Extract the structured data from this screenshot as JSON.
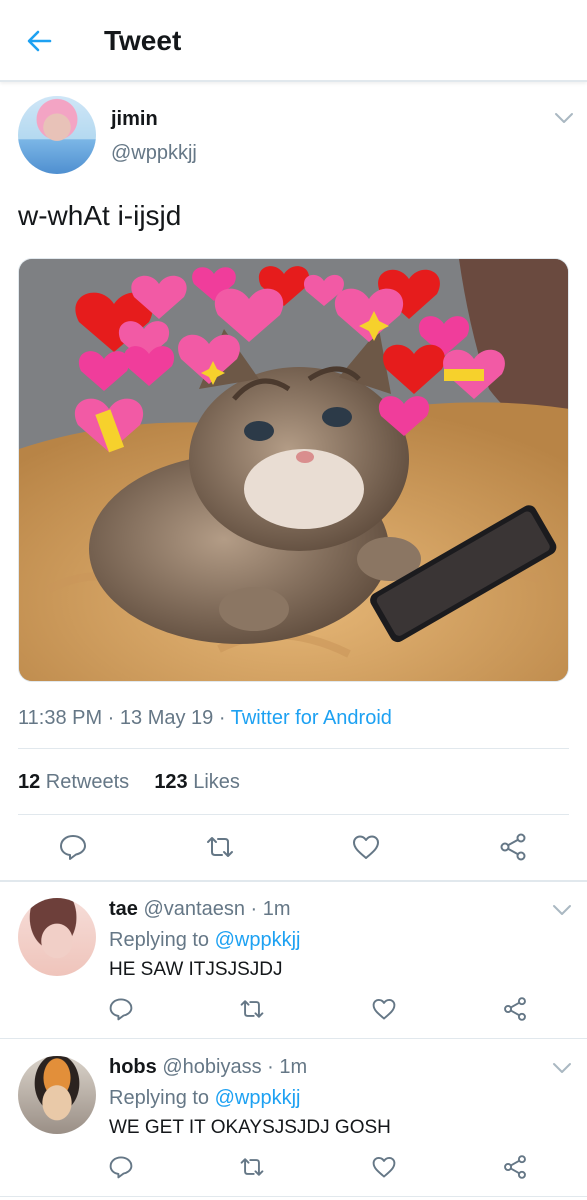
{
  "header": {
    "title": "Tweet"
  },
  "tweet": {
    "name": "jimin",
    "handle": "@wppkkjj",
    "text": "w-whAt i-ijsjd",
    "time": "11:38 PM",
    "sep1": " · ",
    "date": "13 May 19",
    "sep2": " · ",
    "source": "Twitter for Android",
    "retweets_count": "12",
    "retweets_label": " Retweets",
    "likes_count": "123",
    "likes_label": " Likes"
  },
  "replies": [
    {
      "name": "tae",
      "handle": "@vantaesn",
      "time": " · 1m",
      "replying_label": "Replying to ",
      "replying_to": "@wppkkjj",
      "text": "HE SAW ITJSJSJDJ"
    },
    {
      "name": "hobs",
      "handle": "@hobiyass",
      "time": " · 1m",
      "replying_label": "Replying to ",
      "replying_to": "@wppkkjj",
      "text": "WE GET IT OKAYSJSJDJ GOSH"
    }
  ],
  "colors": {
    "accent": "#1da1f2",
    "text": "#14171a",
    "secondary": "#657786",
    "divider": "#e1e8ed"
  },
  "icons": [
    "back-arrow-icon",
    "chevron-down-icon",
    "reply-icon",
    "retweet-icon",
    "like-icon",
    "share-icon"
  ]
}
